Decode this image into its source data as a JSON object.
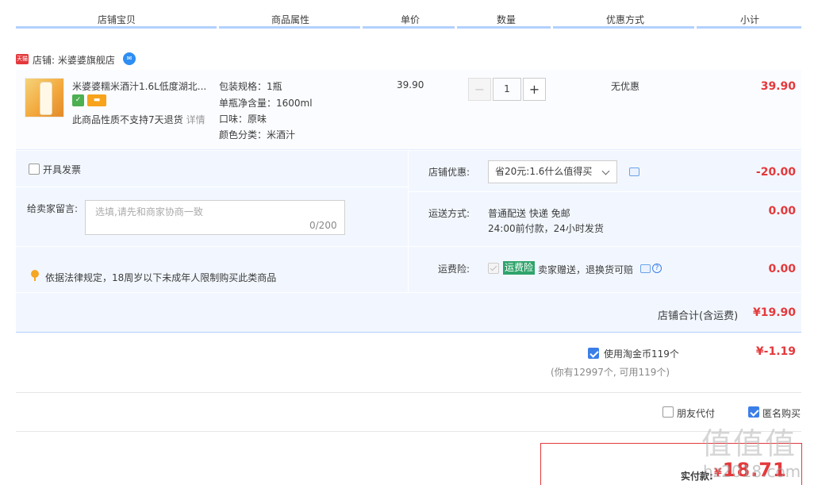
{
  "header": {
    "col_item": "店铺宝贝",
    "col_attr": "商品属性",
    "col_price": "单价",
    "col_qty": "数量",
    "col_discount": "优惠方式",
    "col_subtotal": "小计",
    "accent_color": "#b2d1ff"
  },
  "shop": {
    "badge": "天猫",
    "name": "店铺: 米婆婆旗舰店",
    "ww_icon": "wangwang-chat-icon"
  },
  "item": {
    "title": "米婆婆糯米酒汁1.6L低度湖北...",
    "no_return_note": "此商品性质不支持7天退货",
    "detail_link": "详情",
    "attrs": [
      "包装规格：1瓶",
      "单瓶净含量：1600ml",
      "口味：原味",
      "颜色分类：米酒汁"
    ],
    "unit_price": "39.90",
    "qty_minus": "−",
    "qty_value": "1",
    "qty_plus": "+",
    "discount": "无优惠",
    "subtotal": "39.90"
  },
  "options": {
    "invoice_label": "开具发票",
    "invoice_checked": false,
    "message_label": "给卖家留言:",
    "message_placeholder": "选填,请先和商家协商一致",
    "message_count": "0/200",
    "law_notice": "依据法律规定，18周岁以下未成年人限制购买此类商品",
    "store_discount_label": "店铺优惠:",
    "store_discount_value": "省20元:1.6什么值得买",
    "store_discount_amount": "-20.00",
    "shipping_label": "运送方式:",
    "shipping_line1": "普通配送 快递 免邮",
    "shipping_line2": "24:00前付款，24小时发货",
    "shipping_amount": "0.00",
    "insurance_label": "运费险:",
    "insurance_tag": "运费险",
    "insurance_text": "卖家赠送，退换货可赔",
    "insurance_amount": "0.00",
    "store_total_label": "店铺合计(含运费)",
    "store_total_value": "¥19.90"
  },
  "coins": {
    "label": "使用淘金币119个",
    "checked": true,
    "note": "(你有12997个, 可用119个)",
    "amount": "¥-1.19"
  },
  "extras": {
    "friend_pay": "朋友代付",
    "friend_pay_checked": false,
    "anonymous": "匿名购买",
    "anonymous_checked": true
  },
  "payment": {
    "label": "实付款:",
    "currency": "¥",
    "amount": "18.71",
    "color": "#e4393c"
  },
  "watermark": {
    "text": "值值值",
    "url": "hz2018.com"
  }
}
